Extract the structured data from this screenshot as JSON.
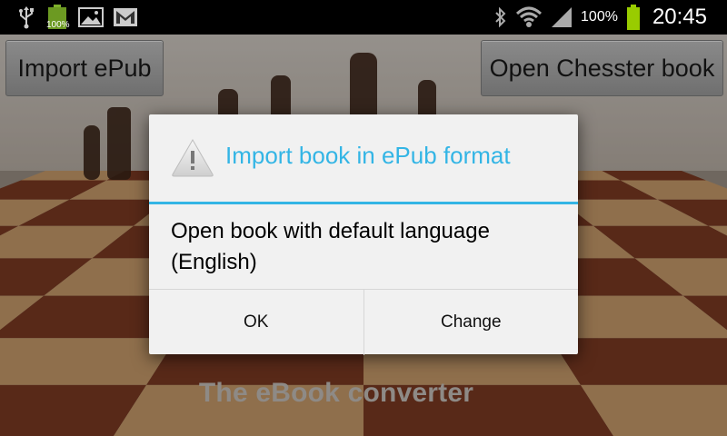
{
  "status_bar": {
    "left_icons": [
      "usb-icon",
      "battery-full-icon",
      "image-icon",
      "gmail-icon"
    ],
    "notification_battery_label": "100%",
    "right_icons": [
      "bluetooth-icon",
      "wifi-icon",
      "signal-icon",
      "battery-icon"
    ],
    "battery_percent": "100%",
    "time": "20:45"
  },
  "app": {
    "import_button_label": "Import ePub",
    "open_button_label": "Open Chesster book",
    "tagline": "The eBook converter"
  },
  "dialog": {
    "title": "Import book in ePub format",
    "message": "Open book with default language (English)",
    "ok_label": "OK",
    "change_label": "Change",
    "accent_color": "#33b5e5"
  }
}
